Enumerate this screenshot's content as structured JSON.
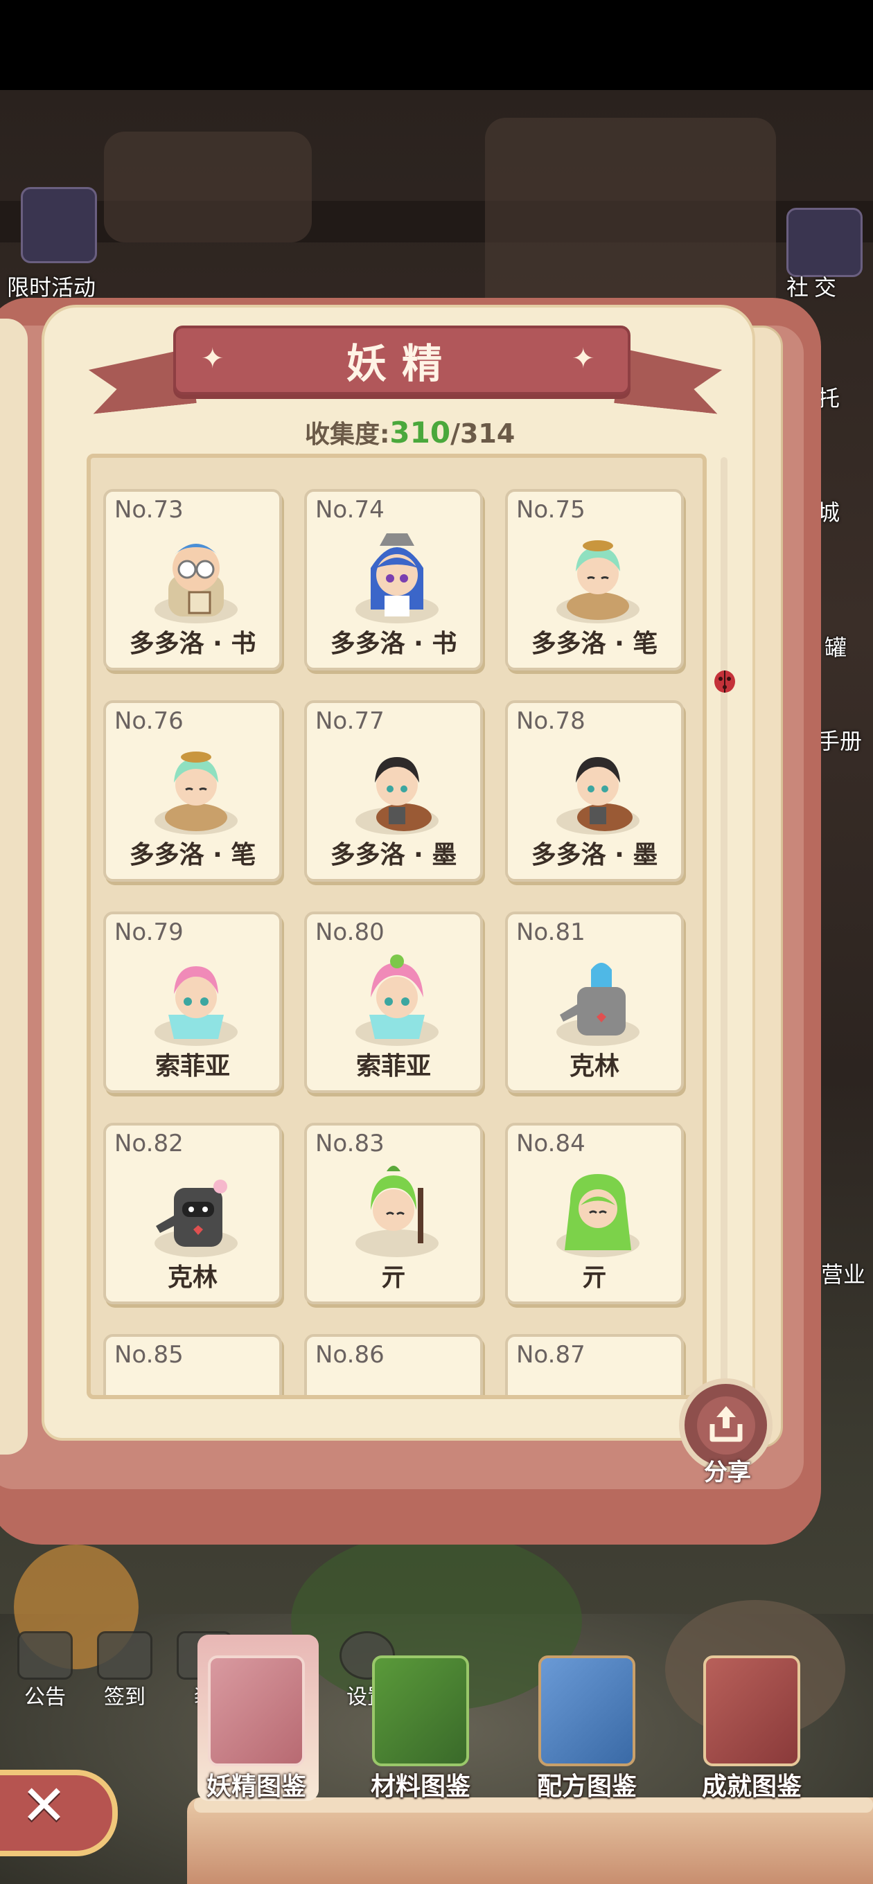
{
  "side": {
    "left_top": "限时活动",
    "right_top": "社交",
    "right_items": [
      "托",
      "城",
      "罐",
      "手册",
      "营业"
    ]
  },
  "book": {
    "title": "妖精",
    "collection_label": "收集度:",
    "collected": "310",
    "total": "/314"
  },
  "cards": [
    {
      "no": "No.73",
      "name": "多多洛 · 书"
    },
    {
      "no": "No.74",
      "name": "多多洛 · 书"
    },
    {
      "no": "No.75",
      "name": "多多洛 · 笔"
    },
    {
      "no": "No.76",
      "name": "多多洛 · 笔"
    },
    {
      "no": "No.77",
      "name": "多多洛 · 墨"
    },
    {
      "no": "No.78",
      "name": "多多洛 · 墨"
    },
    {
      "no": "No.79",
      "name": "索菲亚"
    },
    {
      "no": "No.80",
      "name": "索菲亚"
    },
    {
      "no": "No.81",
      "name": "克林"
    },
    {
      "no": "No.82",
      "name": "克林"
    },
    {
      "no": "No.83",
      "name": "亓"
    },
    {
      "no": "No.84",
      "name": "亓"
    },
    {
      "no": "No.85",
      "name": ""
    },
    {
      "no": "No.86",
      "name": ""
    },
    {
      "no": "No.87",
      "name": ""
    }
  ],
  "share_label": "分享",
  "small_menu": [
    "公告",
    "签到",
    "装",
    "",
    "设置"
  ],
  "tabs": [
    "妖精图鉴",
    "材料图鉴",
    "配方图鉴",
    "成就图鉴"
  ],
  "colors": {
    "ribbon": "#b1575a",
    "page": "#f6ebd0",
    "count_green": "#4aa83c",
    "close": "#b65450"
  }
}
